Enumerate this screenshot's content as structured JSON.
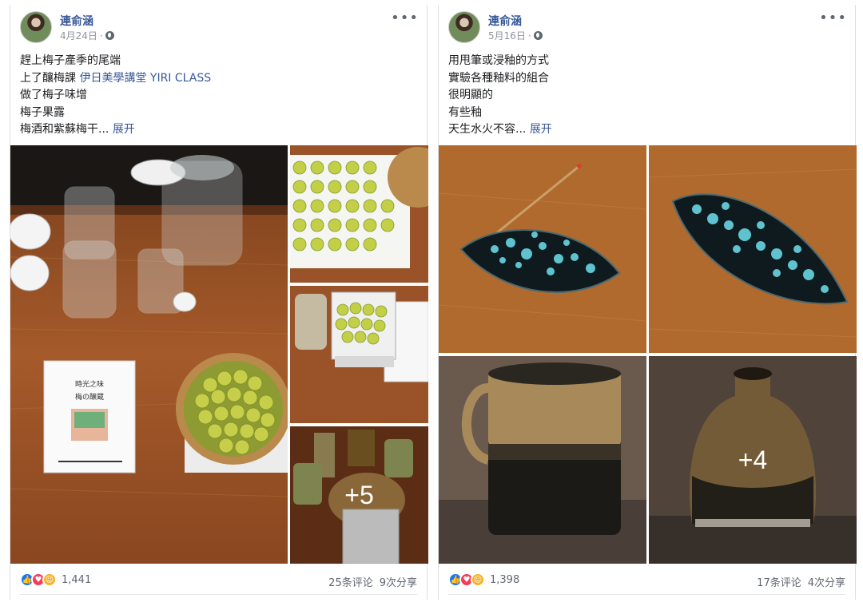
{
  "posts": [
    {
      "author": "連俞涵",
      "date": "4月24日",
      "privacy_icon": "globe-icon",
      "lines": [
        "趕上梅子產季的尾端",
        "上了釀梅課",
        "做了梅子味增",
        "梅子果露",
        "梅酒和紫蘇梅干..."
      ],
      "line2_link": "伊日美學講堂 YIRI CLASS",
      "expand": "展开",
      "photo_overlay": "+5",
      "reaction_count": "1,441",
      "comments": "25条评论",
      "shares": "9次分享",
      "card_lines": [
        "時光之味",
        "梅の醸蔵"
      ]
    },
    {
      "author": "連俞涵",
      "date": "5月16日",
      "privacy_icon": "globe-icon",
      "lines": [
        "用甩筆或浸釉的方式",
        "實驗各種釉料的組合",
        "很明顯的",
        "有些釉",
        "天生水火不容..."
      ],
      "expand": "展开",
      "photo_overlay": "+4",
      "reaction_count": "1,398",
      "comments": "17条评论",
      "shares": "4次分享"
    }
  ],
  "colors": {
    "link": "#385898",
    "wood": "#a0582a",
    "glaze": "#5fc3cf"
  }
}
